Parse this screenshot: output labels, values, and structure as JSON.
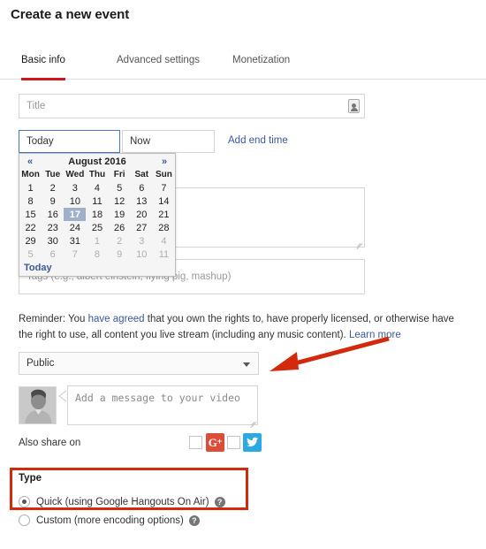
{
  "header": {
    "title": "Create a new event"
  },
  "tabs": [
    {
      "label": "Basic info",
      "active": true
    },
    {
      "label": "Advanced settings",
      "active": false
    },
    {
      "label": "Monetization",
      "active": false
    }
  ],
  "form": {
    "title_placeholder": "Title",
    "date_value": "Today",
    "time_value": "Now",
    "add_end_time_label": "Add end time",
    "description_placeholder": "",
    "tags_placeholder": "Tags (e.g., albert einstein, flying pig, mashup)",
    "privacy_value": "Public",
    "message_placeholder": "Add a message to your video",
    "share_label": "Also share on"
  },
  "datepicker": {
    "prev_label": "«",
    "next_label": "»",
    "month_title": "August 2016",
    "weekdays": [
      "Mon",
      "Tue",
      "Wed",
      "Thu",
      "Fri",
      "Sat",
      "Sun"
    ],
    "weeks": [
      [
        {
          "d": "1"
        },
        {
          "d": "2"
        },
        {
          "d": "3"
        },
        {
          "d": "4"
        },
        {
          "d": "5"
        },
        {
          "d": "6"
        },
        {
          "d": "7"
        }
      ],
      [
        {
          "d": "8"
        },
        {
          "d": "9"
        },
        {
          "d": "10"
        },
        {
          "d": "11"
        },
        {
          "d": "12"
        },
        {
          "d": "13"
        },
        {
          "d": "14"
        }
      ],
      [
        {
          "d": "15"
        },
        {
          "d": "16"
        },
        {
          "d": "17",
          "selected": true
        },
        {
          "d": "18"
        },
        {
          "d": "19"
        },
        {
          "d": "20"
        },
        {
          "d": "21"
        }
      ],
      [
        {
          "d": "22"
        },
        {
          "d": "23"
        },
        {
          "d": "24"
        },
        {
          "d": "25"
        },
        {
          "d": "26"
        },
        {
          "d": "27"
        },
        {
          "d": "28"
        }
      ],
      [
        {
          "d": "29"
        },
        {
          "d": "30"
        },
        {
          "d": "31"
        },
        {
          "d": "1",
          "muted": true
        },
        {
          "d": "2",
          "muted": true
        },
        {
          "d": "3",
          "muted": true
        },
        {
          "d": "4",
          "muted": true
        }
      ],
      [
        {
          "d": "5",
          "muted": true
        },
        {
          "d": "6",
          "muted": true
        },
        {
          "d": "7",
          "muted": true
        },
        {
          "d": "8",
          "muted": true
        },
        {
          "d": "9",
          "muted": true
        },
        {
          "d": "10",
          "muted": true
        },
        {
          "d": "11",
          "muted": true
        }
      ]
    ],
    "today_label": "Today",
    "selected_day": "17"
  },
  "reminder": {
    "part1": "Reminder: You ",
    "link1": "have agreed",
    "part2": " that you own the rights to, have properly licensed, or otherwise have the right to use, all content you live stream (including any music content). ",
    "link2": "Learn more"
  },
  "type_section": {
    "label": "Type",
    "options": [
      {
        "label": "Quick (using Google Hangouts On Air)",
        "checked": true,
        "help": "?"
      },
      {
        "label": "Custom (more encoding options)",
        "checked": false,
        "help": "?"
      }
    ]
  },
  "social": {
    "gplus_glyph": "G",
    "gplus_plus": "+",
    "twitter_name": "twitter-bird"
  },
  "colors": {
    "accent_red": "#cc181e",
    "annotation_red": "#d32a0e",
    "link_blue": "#3b5998",
    "focus_blue": "#4a77c4",
    "selected_day_bg": "#9eb1c9",
    "gplus_red": "#dd4b39",
    "twitter_blue": "#2ca9e1"
  }
}
